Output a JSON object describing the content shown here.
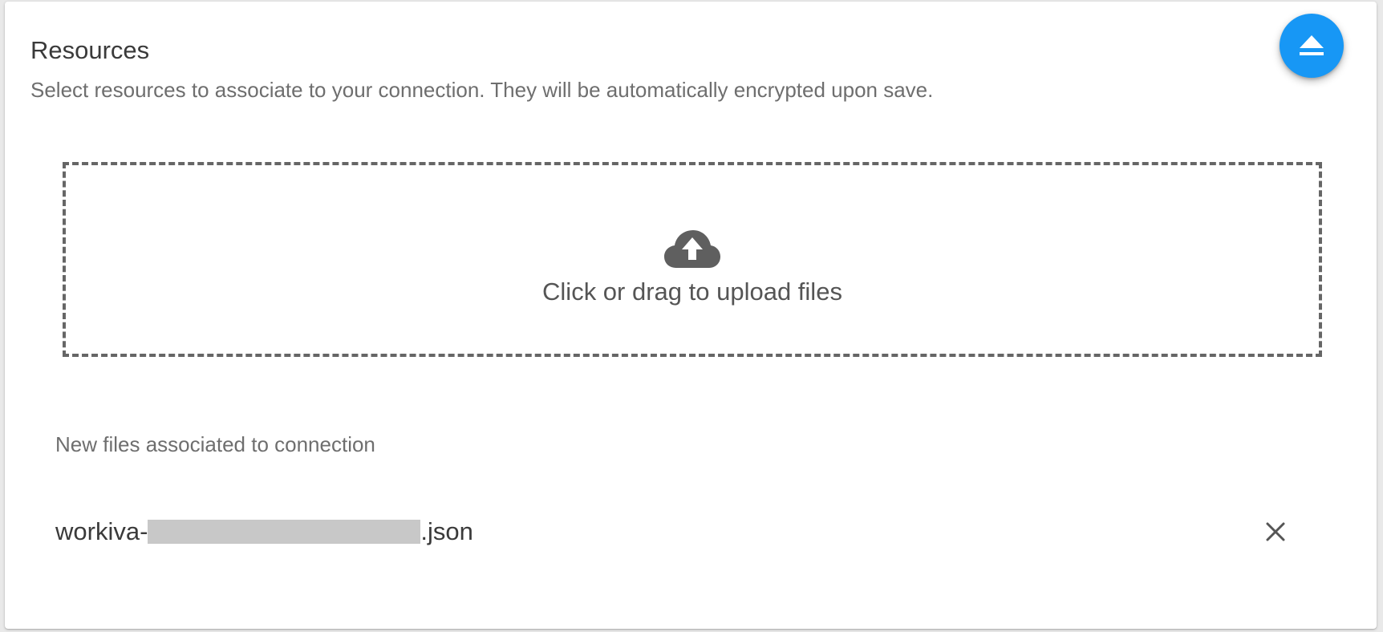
{
  "section": {
    "title": "Resources",
    "description": "Select resources to associate to your connection. They will be automatically encrypted upon save."
  },
  "fab": {
    "icon": "eject-icon",
    "color": "#1797f5"
  },
  "upload": {
    "icon": "cloud-upload-icon",
    "label": "Click or drag to upload files"
  },
  "files": {
    "heading": "New files associated to connection",
    "items": [
      {
        "name_prefix": "workiva-",
        "name_suffix": ".json",
        "remove_icon": "close-icon"
      }
    ]
  }
}
